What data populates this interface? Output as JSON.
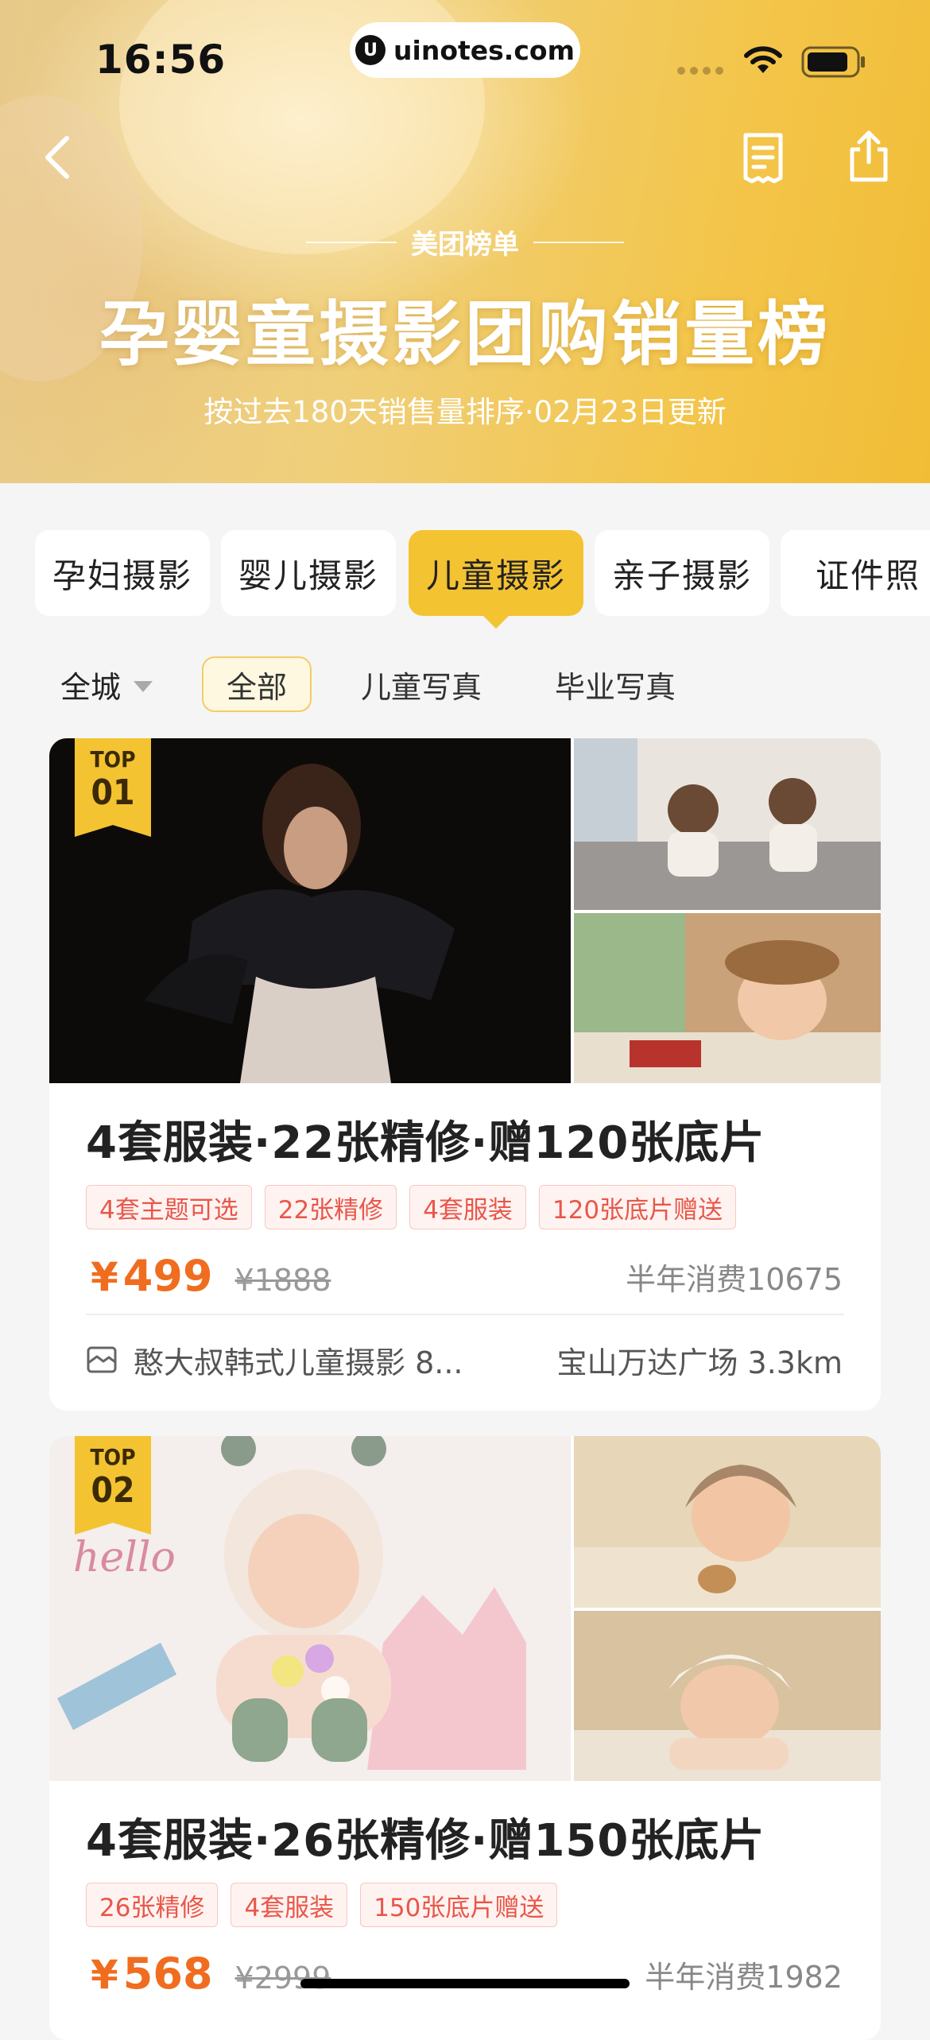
{
  "status_bar": {
    "time": "16:56",
    "url": "uinotes.com",
    "url_logo": "U"
  },
  "nav": {
    "back_icon": "chevron-left-icon",
    "list_icon": "receipt-icon",
    "share_icon": "share-icon"
  },
  "hero": {
    "brand": "美团榜单",
    "title": "孕婴童摄影团购销量榜",
    "subtitle": "按过去180天销售量排序·02月23日更新"
  },
  "category_tabs": [
    {
      "label": "孕妇摄影",
      "active": false
    },
    {
      "label": "婴儿摄影",
      "active": false
    },
    {
      "label": "儿童摄影",
      "active": true
    },
    {
      "label": "亲子摄影",
      "active": false
    },
    {
      "label": "证件照",
      "active": false
    }
  ],
  "filters": {
    "city": "全城",
    "chips": [
      {
        "label": "全部",
        "active": true
      },
      {
        "label": "儿童写真",
        "active": false
      },
      {
        "label": "毕业写真",
        "active": false
      }
    ]
  },
  "products": [
    {
      "rank_top": "TOP",
      "rank_num": "01",
      "title": "4套服装·22张精修·赠120张底片",
      "tags": [
        "4套主题可选",
        "22张精修",
        "4套服装",
        "120张底片赠送"
      ],
      "price_symbol": "¥",
      "price": "499",
      "original_price": "¥1888",
      "sales": "半年消费10675",
      "shop": "憨大叔韩式儿童摄影 8...",
      "location": "宝山万达广场 3.3km"
    },
    {
      "rank_top": "TOP",
      "rank_num": "02",
      "title": "4套服装·26张精修·赠150张底片",
      "tags": [
        "26张精修",
        "4套服装",
        "150张底片赠送"
      ],
      "price_symbol": "¥",
      "price": "568",
      "original_price": "¥2999",
      "sales": "半年消费1982"
    }
  ],
  "colors": {
    "accent_yellow": "#f4c332",
    "price_orange": "#f06d1f",
    "tag_red": "#e8574a"
  }
}
